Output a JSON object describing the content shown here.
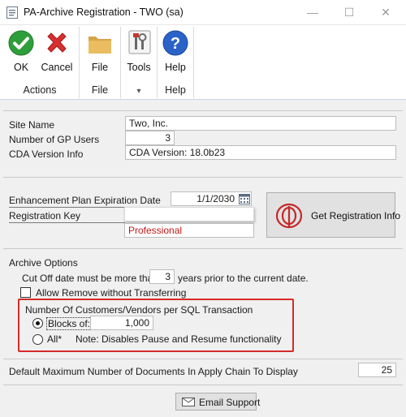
{
  "window": {
    "title": "PA-Archive Registration  -  TWO (sa)",
    "controls": {
      "minimize": "—",
      "maximize": "☐",
      "close": "✕"
    }
  },
  "ribbon": {
    "ok_label": "OK",
    "cancel_label": "Cancel",
    "file_label": "File",
    "tools_label": "Tools",
    "help_label": "Help",
    "groups": {
      "actions": "Actions",
      "file": "File",
      "tools": "▾",
      "help": "Help"
    },
    "colors": {
      "ok_green": "#2e9e3a",
      "cancel_red": "#d72f2f",
      "help_blue": "#2a62c8",
      "folder": "#d6a547"
    }
  },
  "info": {
    "site_name_label": "Site Name",
    "site_name_value": "Two, Inc.",
    "users_label": "Number of GP Users",
    "users_value": "3",
    "cda_label": "CDA Version Info",
    "cda_value": "CDA Version: 18.0b23"
  },
  "registration": {
    "expiration_label": "Enhancement Plan Expiration Date",
    "expiration_value": "1/1/2030",
    "key_label": "Registration Key",
    "key_value": "",
    "edition_value": "Professional",
    "get_registration_label": "Get Registration Info"
  },
  "archive": {
    "section_label": "Archive Options",
    "cutoff_prefix": "Cut Off date must be more than",
    "cutoff_years": "3",
    "cutoff_suffix": "years prior to the current date.",
    "allow_remove_label": "Allow Remove without Transferring",
    "allow_remove_checked": false,
    "group_title": "Number Of Customers/Vendors per SQL Transaction",
    "blocks_label": "Blocks of:",
    "blocks_value": "1,000",
    "all_label": "All*",
    "all_note": "Note: Disables Pause and Resume functionality",
    "selected_option": "blocks"
  },
  "apply_chain": {
    "label": "Default Maximum Number of Documents In Apply Chain To Display",
    "value": "25"
  },
  "footer": {
    "email_support_label": "Email Support"
  }
}
